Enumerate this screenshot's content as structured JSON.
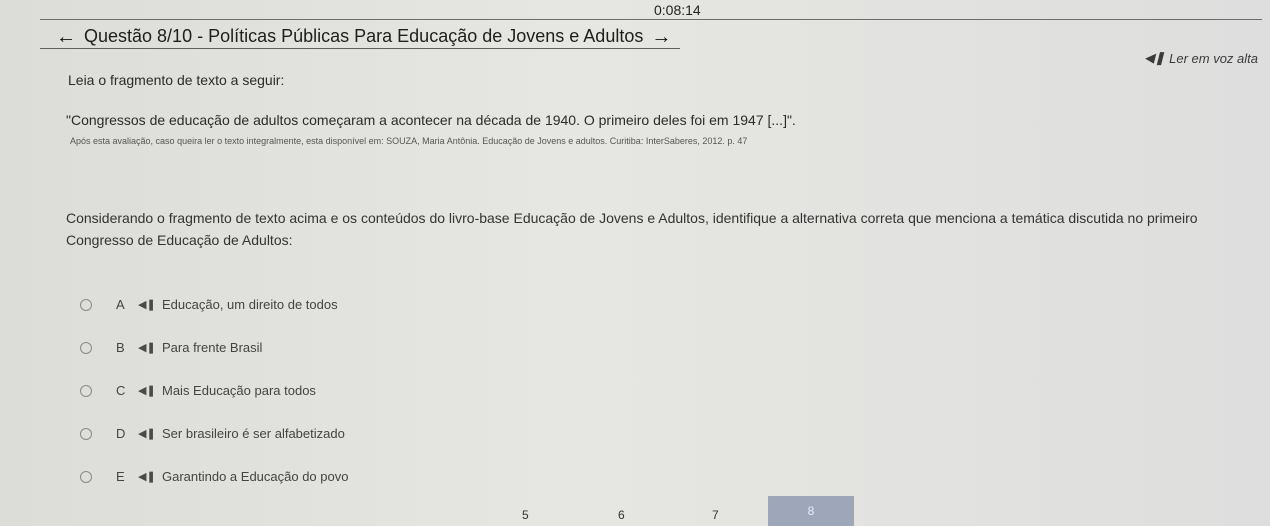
{
  "timer": "0:08:14",
  "header": {
    "title": "Questão 8/10 - Políticas Públicas Para Educação de Jovens e Adultos",
    "prev_icon": "arrow-left-icon",
    "next_icon": "arrow-right-icon"
  },
  "tts": {
    "icon": "speaker-icon",
    "label": "Ler em voz alta"
  },
  "intro": "Leia o fragmento de texto a seguir:",
  "quote": "\"Congressos de educação de adultos começaram a acontecer na década de 1940. O primeiro deles foi em 1947 [...]\".",
  "source": "Após esta avaliação, caso queira ler o texto integralmente, esta disponível em: SOUZA, Maria Antônia. Educação de Jovens e adultos. Curitiba: InterSaberes, 2012. p. 47",
  "question": "Considerando o fragmento de texto acima e os conteúdos do livro-base Educação de Jovens e Adultos, identifique a alternativa correta que menciona a temática discutida no primeiro Congresso de Educação de Adultos:",
  "options": [
    {
      "letter": "A",
      "text": "Educação, um direito de todos"
    },
    {
      "letter": "B",
      "text": "Para frente Brasil"
    },
    {
      "letter": "C",
      "text": "Mais Educação para todos"
    },
    {
      "letter": "D",
      "text": "Ser brasileiro é ser alfabetizado"
    },
    {
      "letter": "E",
      "text": "Garantindo a Educação do povo"
    }
  ],
  "pager": {
    "pages": [
      "5",
      "6",
      "7",
      "8"
    ],
    "current": "8"
  }
}
